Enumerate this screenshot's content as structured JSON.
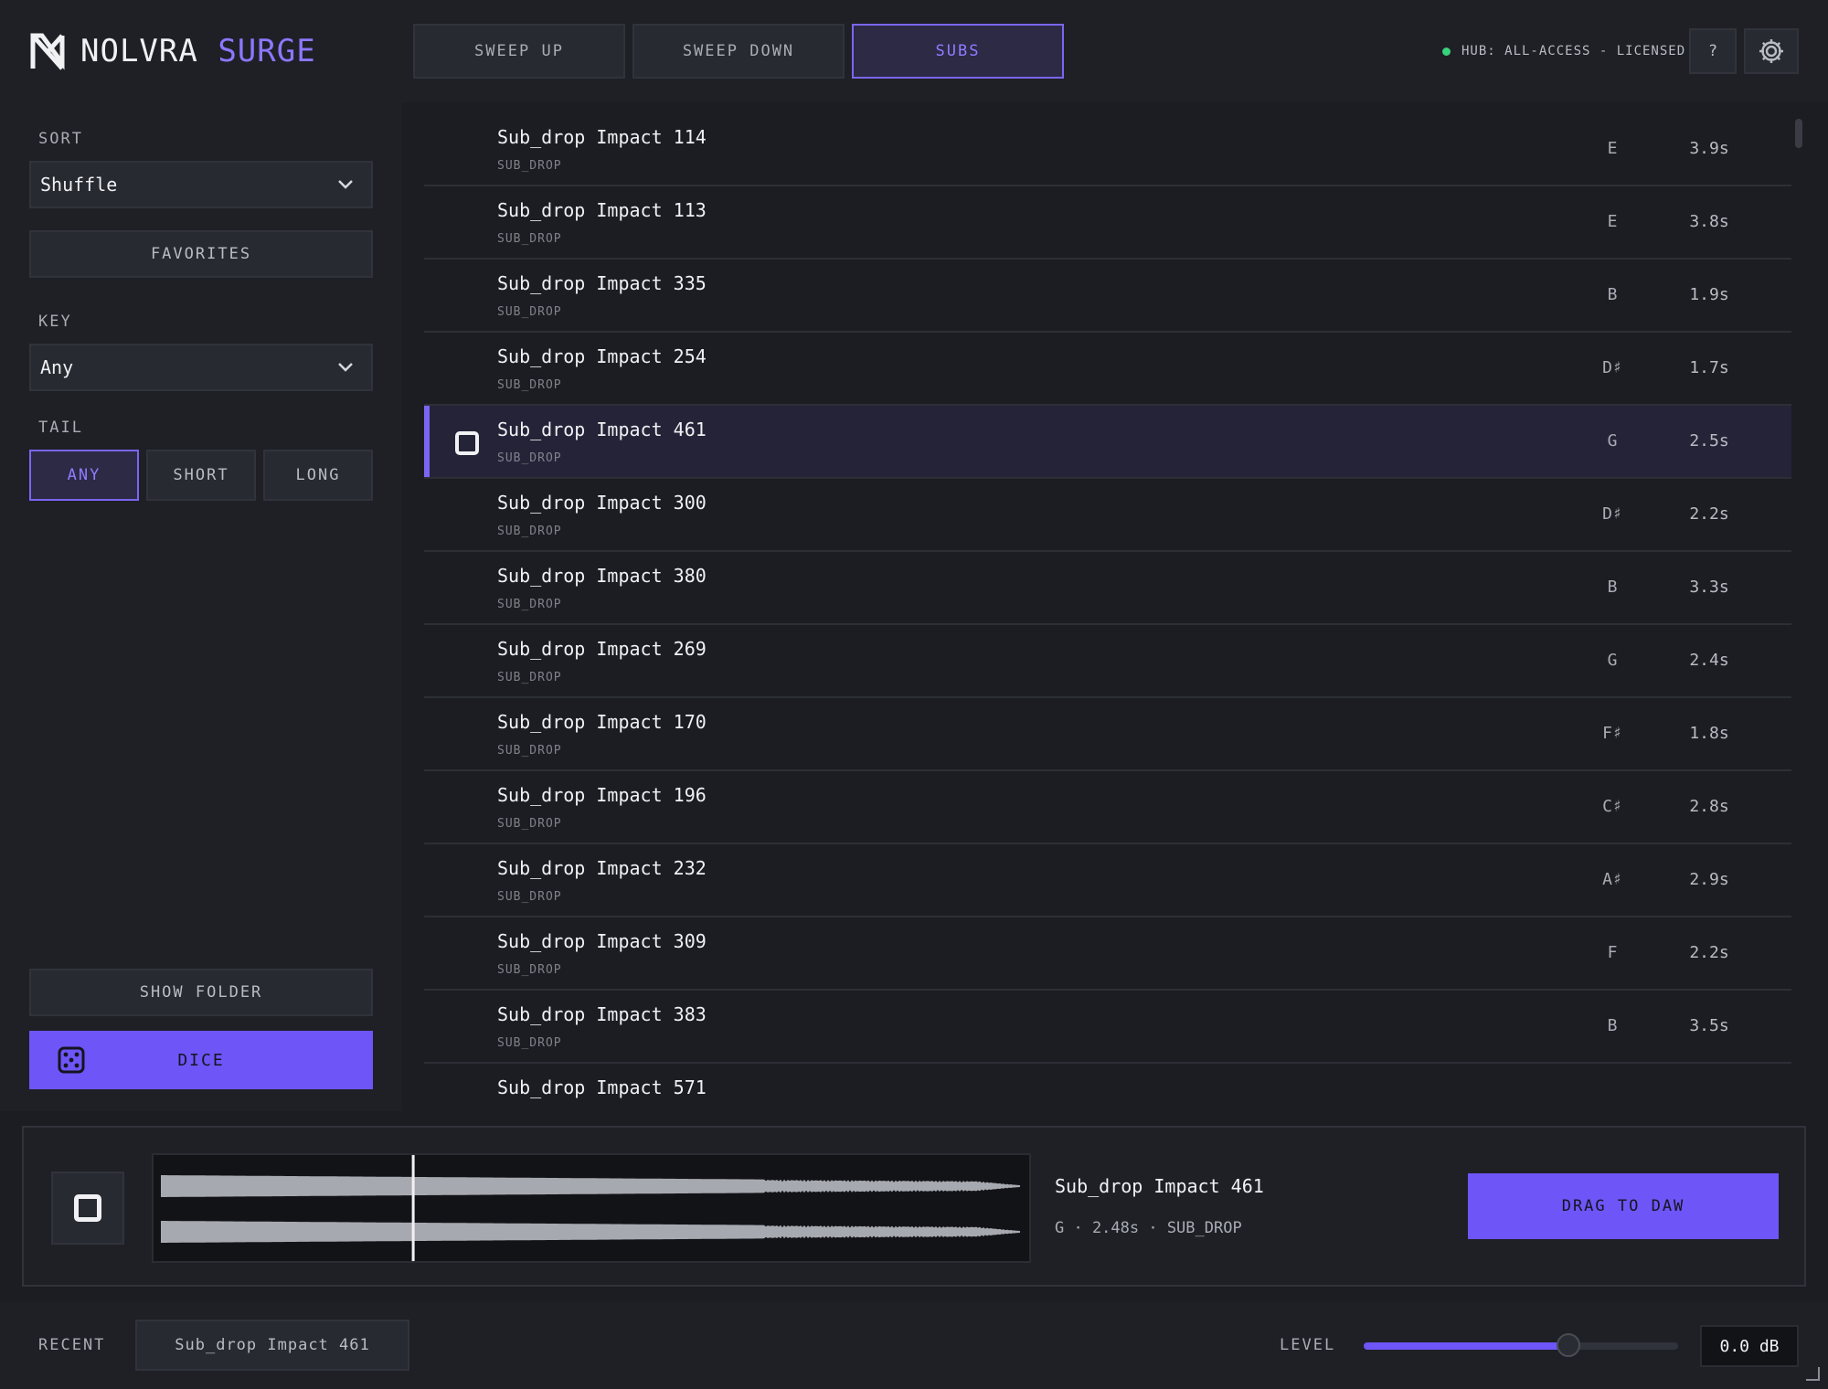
{
  "app": {
    "brand": "NOLVRA",
    "product": "SURGE",
    "accent_color": "#7a66f2"
  },
  "header": {
    "tabs": [
      {
        "label": "SWEEP UP",
        "active": false
      },
      {
        "label": "SWEEP DOWN",
        "active": false
      },
      {
        "label": "SUBS",
        "active": true
      }
    ],
    "license": "HUB: ALL-ACCESS - LICENSED",
    "license_status_color": "#38d27a",
    "help_label": "?",
    "settings_icon": "gear-icon"
  },
  "sidebar": {
    "sort_label": "SORT",
    "sort_value": "Shuffle",
    "favorites_label": "FAVORITES",
    "key_label": "KEY",
    "key_value": "Any",
    "tail_label": "TAIL",
    "tail_options": [
      {
        "label": "ANY",
        "active": true
      },
      {
        "label": "SHORT",
        "active": false
      },
      {
        "label": "LONG",
        "active": false
      }
    ],
    "show_folder_label": "SHOW FOLDER",
    "dice_label": "DICE"
  },
  "list": {
    "items": [
      {
        "name": "Sub_drop Impact 114",
        "category": "SUB_DROP",
        "key": "E",
        "duration": "3.9s",
        "selected": false
      },
      {
        "name": "Sub_drop Impact 113",
        "category": "SUB_DROP",
        "key": "E",
        "duration": "3.8s",
        "selected": false
      },
      {
        "name": "Sub_drop Impact 335",
        "category": "SUB_DROP",
        "key": "B",
        "duration": "1.9s",
        "selected": false
      },
      {
        "name": "Sub_drop Impact 254",
        "category": "SUB_DROP",
        "key": "D♯",
        "duration": "1.7s",
        "selected": false
      },
      {
        "name": "Sub_drop Impact 461",
        "category": "SUB_DROP",
        "key": "G",
        "duration": "2.5s",
        "selected": true
      },
      {
        "name": "Sub_drop Impact 300",
        "category": "SUB_DROP",
        "key": "D♯",
        "duration": "2.2s",
        "selected": false
      },
      {
        "name": "Sub_drop Impact 380",
        "category": "SUB_DROP",
        "key": "B",
        "duration": "3.3s",
        "selected": false
      },
      {
        "name": "Sub_drop Impact 269",
        "category": "SUB_DROP",
        "key": "G",
        "duration": "2.4s",
        "selected": false
      },
      {
        "name": "Sub_drop Impact 170",
        "category": "SUB_DROP",
        "key": "F♯",
        "duration": "1.8s",
        "selected": false
      },
      {
        "name": "Sub_drop Impact 196",
        "category": "SUB_DROP",
        "key": "C♯",
        "duration": "2.8s",
        "selected": false
      },
      {
        "name": "Sub_drop Impact 232",
        "category": "SUB_DROP",
        "key": "A♯",
        "duration": "2.9s",
        "selected": false
      },
      {
        "name": "Sub_drop Impact 309",
        "category": "SUB_DROP",
        "key": "F",
        "duration": "2.2s",
        "selected": false
      },
      {
        "name": "Sub_drop Impact 383",
        "category": "SUB_DROP",
        "key": "B",
        "duration": "3.5s",
        "selected": false
      },
      {
        "name": "Sub_drop Impact 571",
        "category": "",
        "key": "",
        "duration": "",
        "selected": false
      }
    ]
  },
  "player": {
    "name": "Sub_drop Impact 461",
    "meta": "G · 2.48s · SUB_DROP",
    "playhead_fraction": 0.295,
    "drag_label": "DRAG TO DAW"
  },
  "footer": {
    "recent_label": "RECENT",
    "recent_item": "Sub_drop Impact 461",
    "level_label": "LEVEL",
    "level_fraction": 0.65,
    "level_value": "0.0 dB"
  }
}
